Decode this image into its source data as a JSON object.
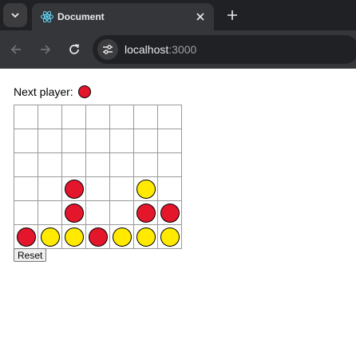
{
  "browser": {
    "tab_title": "Document",
    "url_host": "localhost",
    "url_port": ":3000",
    "icons": {
      "tab_menu": "chevron-down-icon",
      "favicon": "react-icon",
      "tab_close": "close-icon",
      "new_tab": "plus-icon",
      "back": "arrow-left-icon",
      "forward": "arrow-right-icon",
      "reload": "reload-icon",
      "site_info": "site-info-icon"
    }
  },
  "game": {
    "next_player_label": "Next player:",
    "next_player": "red",
    "colors": {
      "red": "#e4162b",
      "yellow": "#ffea00"
    },
    "board": [
      [
        null,
        null,
        null,
        null,
        null,
        null,
        null
      ],
      [
        null,
        null,
        null,
        null,
        null,
        null,
        null
      ],
      [
        null,
        null,
        null,
        null,
        null,
        null,
        null
      ],
      [
        null,
        null,
        "red",
        null,
        null,
        "yellow",
        null
      ],
      [
        null,
        null,
        "red",
        null,
        null,
        "red",
        "red"
      ],
      [
        "red",
        "yellow",
        "yellow",
        "red",
        "yellow",
        "yellow",
        "yellow"
      ]
    ],
    "reset_label": "Reset"
  }
}
